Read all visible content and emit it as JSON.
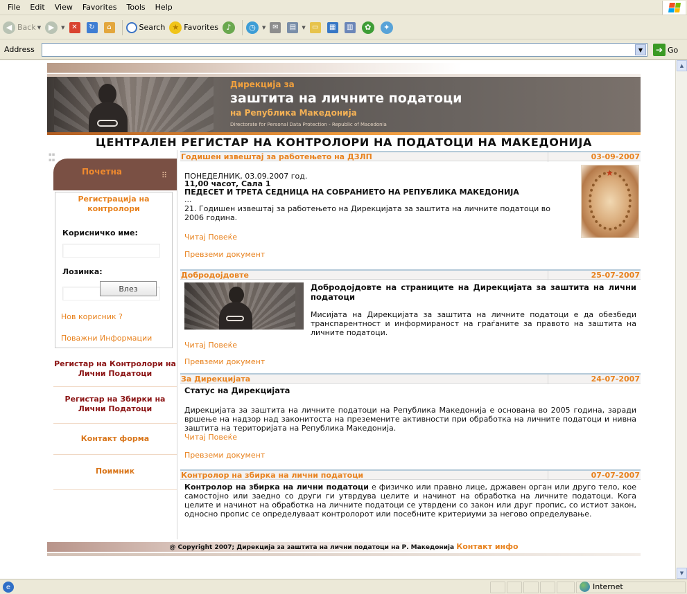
{
  "browser": {
    "menu": [
      "File",
      "Edit",
      "View",
      "Favorites",
      "Tools",
      "Help"
    ],
    "toolbar": {
      "back": "Back",
      "search": "Search",
      "favorites": "Favorites"
    },
    "address_label": "Address",
    "address_value": "",
    "go_label": "Go",
    "status_zone": "Internet"
  },
  "header": {
    "line1": "Дирекција за",
    "line2": "заштита на личните податоци",
    "line3": "на Република Македонија",
    "line4": "Directorate for Personal Data Protection - Republic of Macedonia",
    "register_title": "ЦЕНТРАЛЕН РЕГИСТАР НА  КОНТРОЛОРИ НА ПОДАТОЦИ НА МАКЕДОНИЈА"
  },
  "sidebar": {
    "home": "Почетна",
    "registration_title": "Регистрација на контролори",
    "username_label": "Корисничко име:",
    "password_label": "Лозинка:",
    "login_button": "Влез",
    "new_user": "Нов корисник ?",
    "important_info": "Поважни Информации",
    "menu": [
      "Регистар на Контролори на Лични Податоци",
      "Регистар на Збирки на Лични Податоци",
      "Контакт форма",
      "Поимник"
    ]
  },
  "news": [
    {
      "title": "Годишен извештај за работењето на ДЗЛП",
      "date": "03-09-2007",
      "line1": "ПОНЕДЕЛНИК, 03.09.2007 год.",
      "line2": "11,00 часот, Сала 1",
      "line3": "ПЕДЕСЕТ И ТРЕТА СЕДНИЦА НА СОБРАНИЕТО НА РЕПУБЛИКА МАКЕДОНИЈА",
      "line4": "...",
      "text": "21. Годишен извештај за работењето на Дирекцијата за заштита на личните податоци во 2006 година.",
      "read_more": "Читај Повеќе",
      "download": "Превземи документ"
    },
    {
      "title": "Добродојдовте",
      "date": "25-07-2007",
      "heading": "Добродојдовте на страниците на Дирекцијата за заштита на лични податоци",
      "text": "Мисијата на Дирекцијата за заштита на личните податоци е да обезбеди транспарентност и информираност на граѓаните за правото на заштита на личните податоци.",
      "read_more": "Читај Повеќе",
      "download": "Превземи документ"
    },
    {
      "title": "За Дирекцијата",
      "date": "24-07-2007",
      "heading": "Статус на Дирекцијата",
      "text": "Дирекцијата за заштита на личните податоци на Република Македонија е основана во 2005 година, заради вршење на надзор над законитоста на преземените активности при обработка на личните податоци и нивна заштита на територијата на Република Македонија.",
      "read_more": "Читај Повеќе",
      "download": "Превземи документ"
    },
    {
      "title": "Контролор на збирка на лични податоци",
      "date": "07-07-2007",
      "bold_lead": "Контролор на збирка на лични податоци",
      "text": " е физичко или правно лице, државен орган или друго тело, кое самостојно или заедно со други ги утврдува целите и начинот на обработка на личните податоци. Кога целите и начинот на обработка на личните податоци се утврдени со закон или друг пропис, со истиот закон, односно пропис се определуваат контролорот или посебните критериуми за негово определување."
    }
  ],
  "footer": {
    "copyright": "@ Copyright  2007; Дирекција за заштита на лични податоци на Р. Македонија",
    "contact": "Контакт инфо"
  }
}
